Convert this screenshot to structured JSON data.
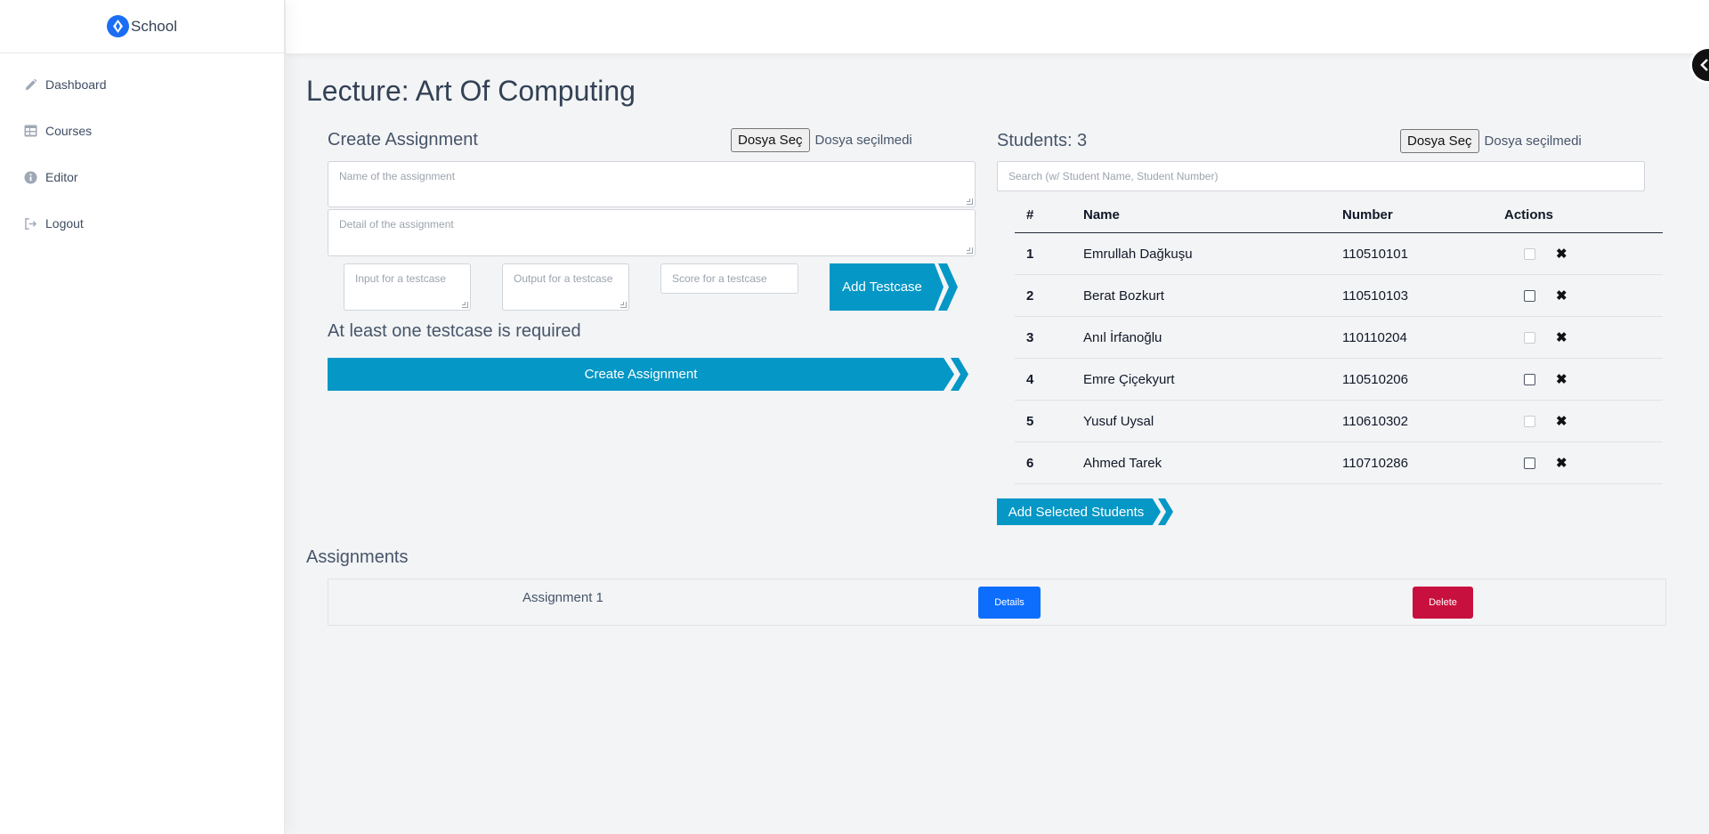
{
  "brand": {
    "name": "School",
    "icon": "school-logo-icon"
  },
  "sidebar": {
    "items": [
      {
        "label": "Dashboard",
        "icon": "pencil-icon"
      },
      {
        "label": "Courses",
        "icon": "table-icon"
      },
      {
        "label": "Editor",
        "icon": "info-icon"
      },
      {
        "label": "Logout",
        "icon": "logout-icon"
      }
    ]
  },
  "page": {
    "title": "Lecture: Art Of Computing"
  },
  "create": {
    "title": "Create Assignment",
    "file_button": "Dosya Seç",
    "file_status": "Dosya seçilmedi",
    "name_placeholder": "Name of the assignment",
    "detail_placeholder": "Detail of the assignment",
    "input_placeholder": "Input for a testcase",
    "output_placeholder": "Output for a testcase",
    "score_placeholder": "Score for a testcase",
    "add_testcase_label": "Add Testcase",
    "required_note": "At least one testcase is required",
    "submit_label": "Create Assignment"
  },
  "students": {
    "title": "Students: 3",
    "file_button": "Dosya Seç",
    "file_status": "Dosya seçilmedi",
    "search_placeholder": "Search (w/ Student Name, Student Number)",
    "columns": [
      "#",
      "Name",
      "Number",
      "Actions"
    ],
    "rows": [
      {
        "index": "1",
        "name": "Emrullah Dağkuşu",
        "number": "110510101",
        "enrolled": true
      },
      {
        "index": "2",
        "name": "Berat Bozkurt",
        "number": "110510103",
        "enrolled": false
      },
      {
        "index": "3",
        "name": "Anıl İrfanoğlu",
        "number": "110110204",
        "enrolled": true
      },
      {
        "index": "4",
        "name": "Emre Çiçekyurt",
        "number": "110510206",
        "enrolled": false
      },
      {
        "index": "5",
        "name": "Yusuf Uysal",
        "number": "110610302",
        "enrolled": true
      },
      {
        "index": "6",
        "name": "Ahmed Tarek",
        "number": "110710286",
        "enrolled": false
      }
    ],
    "add_selected_label": "Add Selected Students"
  },
  "assignments": {
    "title": "Assignments",
    "items": [
      {
        "name": "Assignment 1",
        "details_label": "Details",
        "delete_label": "Delete"
      }
    ]
  },
  "colors": {
    "accent": "#0597c6",
    "primary": "#0d6efd",
    "danger": "#c8103e"
  }
}
